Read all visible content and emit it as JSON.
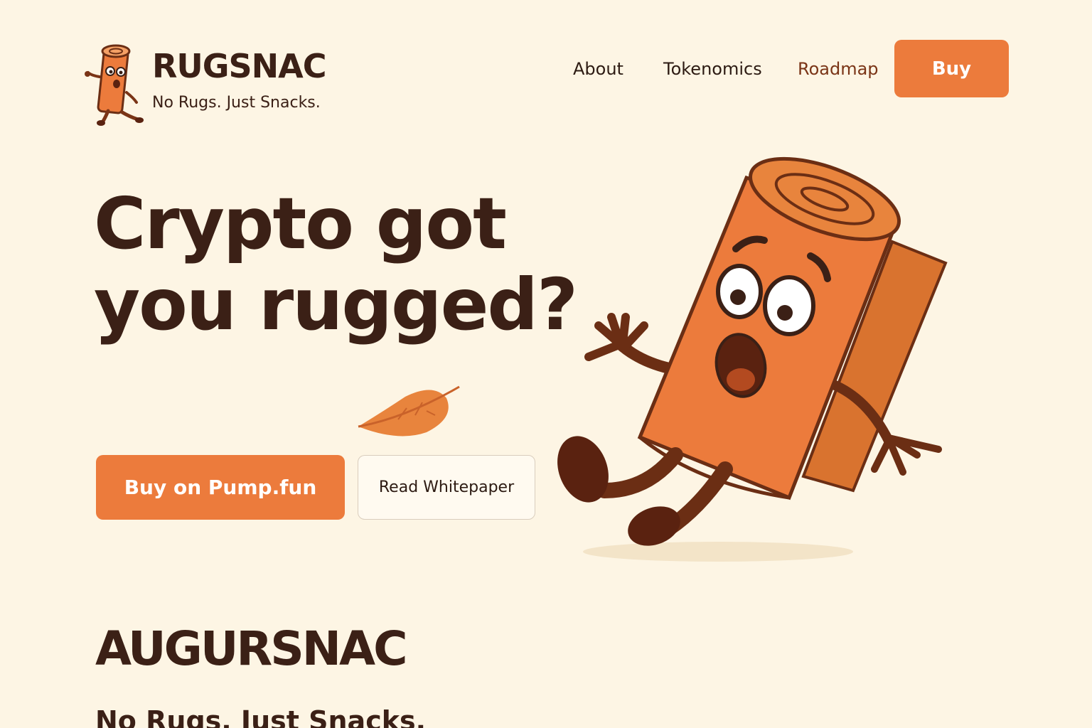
{
  "header": {
    "brand_name": "RUGSNAC",
    "tagline": "No Rugs. Just Snacks.",
    "logo_icon": "rug-mascot-icon"
  },
  "nav": {
    "items": [
      {
        "label": "About"
      },
      {
        "label": "Tokenomics"
      },
      {
        "label": "Roadmap"
      }
    ],
    "buy_label": "Buy"
  },
  "hero": {
    "title_line1": "Crypto got",
    "title_line2": "you rugged?",
    "primary_cta": "Buy on Pump.fun",
    "secondary_cta": "Read Whitepaper",
    "decor_icon": "leaf-icon",
    "illustration": "falling-rug-mascot-icon"
  },
  "section": {
    "logo_text": "AUGURSNAC",
    "tagline": "No Rugs. Just Snacks."
  },
  "colors": {
    "background": "#fdf5e4",
    "accent": "#ec7b3c",
    "text": "#3b2016",
    "active_nav": "#7a3416"
  }
}
